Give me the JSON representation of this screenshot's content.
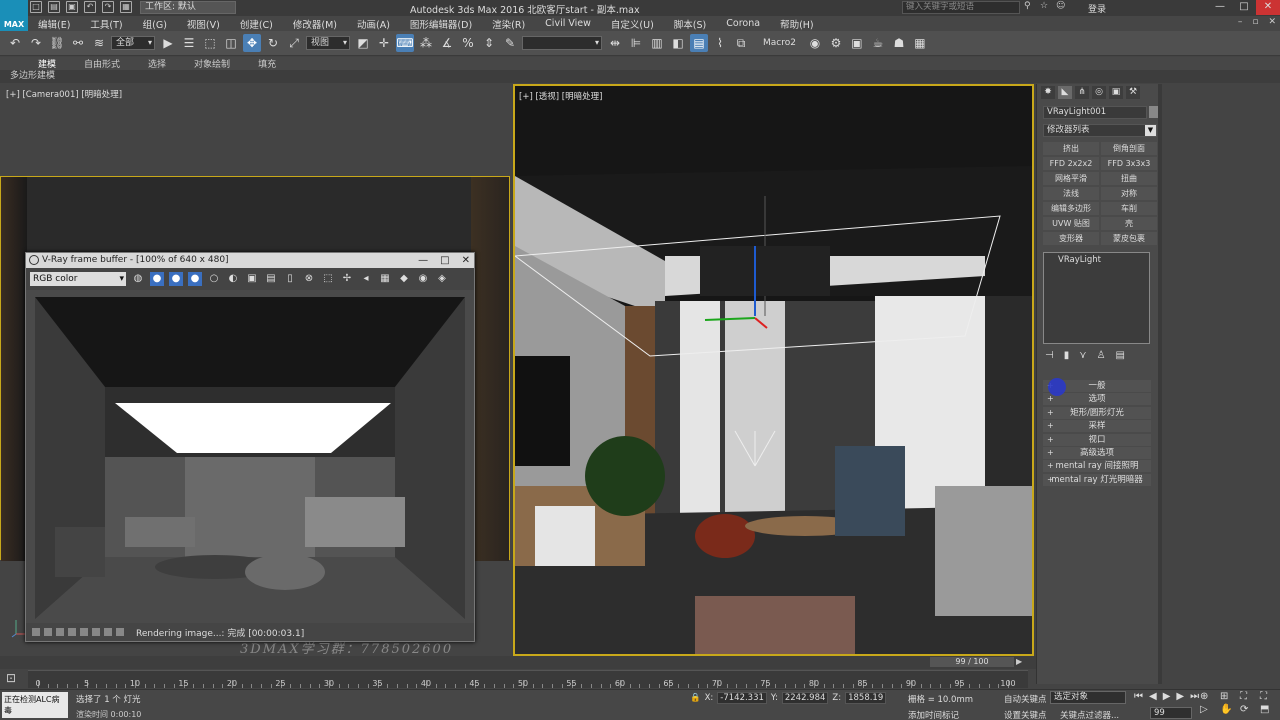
{
  "app": {
    "logo": "MAX",
    "workspace": "工作区: 默认",
    "title": "Autodesk 3ds Max 2016    北欧客厅start - 副本.max",
    "search_placeholder": "键入关键字或短语",
    "login": "登录",
    "qat_icons": [
      "new-icon",
      "open-icon",
      "save-icon",
      "undo-icon",
      "redo-icon",
      "project-icon"
    ]
  },
  "menubar": [
    "编辑(E)",
    "工具(T)",
    "组(G)",
    "视图(V)",
    "创建(C)",
    "修改器(M)",
    "动画(A)",
    "图形编辑器(D)",
    "渲染(R)",
    "Civil View",
    "自定义(U)",
    "脚本(S)",
    "Corona",
    "帮助(H)"
  ],
  "toolbar": {
    "selection_filter": "全部",
    "reference_coord": "视图",
    "named_selection": "",
    "macro": "Macro2"
  },
  "ribbon": {
    "tabs": [
      "建模",
      "自由形式",
      "选择",
      "对象绘制",
      "填充"
    ],
    "active": "建模",
    "sub": "多边形建模"
  },
  "viewport_left": {
    "label": "[+] [Camera001] [明暗处理]",
    "watermark": "3DMAX学习群：778502600"
  },
  "viewport_right": {
    "label": "[+] [透视] [明暗处理]"
  },
  "vfb": {
    "title": "V-Ray frame buffer - [100% of 640 x 480]",
    "channel": "RGB color",
    "status": "Rendering image...: 完成 [00:00:03.1]"
  },
  "command_panel": {
    "object_name": "VRayLight001",
    "modifier_list": "修改器列表",
    "modifier_buttons": [
      "挤出",
      "倒角剖面",
      "FFD 2x2x2",
      "FFD 3x3x3",
      "网格平滑",
      "扭曲",
      "法线",
      "对称",
      "编辑多边形",
      "车削",
      "UVW 贴图",
      "壳",
      "变形器",
      "蒙皮包裹"
    ],
    "stack_item": "VRayLight",
    "rollouts": [
      "一般",
      "选项",
      "矩形/圆形灯光",
      "采样",
      "视口",
      "高级选项",
      "mental ray 间接照明",
      "mental ray 灯光明暗器"
    ]
  },
  "timeline": {
    "frame_counter": "99 / 100",
    "ticks": [
      "0",
      "5",
      "10",
      "15",
      "20",
      "25",
      "30",
      "35",
      "40",
      "45",
      "50",
      "55",
      "60",
      "65",
      "70",
      "75",
      "80",
      "85",
      "90",
      "95",
      "100"
    ]
  },
  "statusbar": {
    "maxscript": "正在检测ALC病毒",
    "message": "选择了 1 个 灯光",
    "prompt": "渲染时间 0:00:10",
    "x_label": "X:",
    "x_value": "-7142.331",
    "y_label": "Y:",
    "y_value": "2242.984",
    "z_label": "Z:",
    "z_value": "1858.19",
    "grid": "栅格 = 10.0mm",
    "add_tag": "添加时间标记",
    "auto_key": "自动关键点",
    "selection_filter": "选定对象",
    "set_key": "设置关键点",
    "key_filters": "关键点过滤器...",
    "current_frame": "99"
  }
}
